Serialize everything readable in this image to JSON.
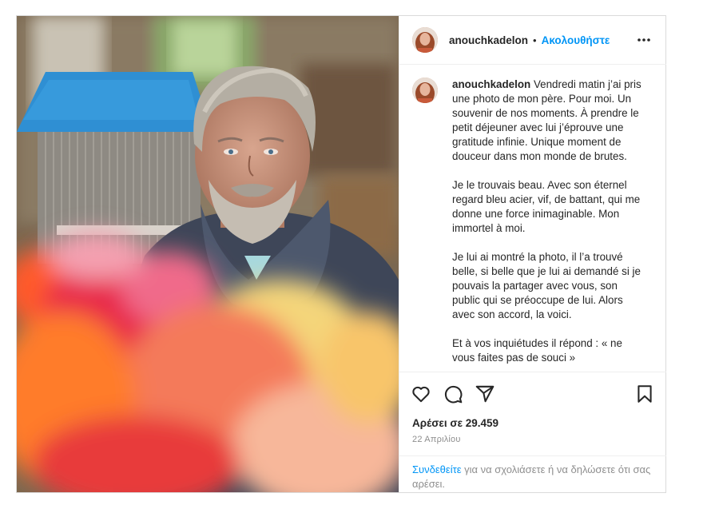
{
  "post": {
    "username": "anouchkadelon",
    "separator": "•",
    "follow_label": "Ακολουθήστε",
    "more_icon": "more-horizontal-icon",
    "caption": {
      "username": "anouchkadelon",
      "paragraphs": [
        "Vendredi matin j’ai pris une photo de mon père. Pour moi. Un souvenir de nos moments. À prendre le petit déjeuner avec lui j’éprouve une gratitude infinie. Unique moment de douceur dans mon monde de brutes.",
        "Je le trouvais beau. Avec son éternel regard bleu acier, vif, de battant, qui me donne une force inimaginable. Mon immortel à moi.",
        "Je lui ai montré la photo, il l’a trouvé belle, si belle que je lui ai demandé si je pouvais la partager avec vous, son public qui se préoccupe de lui. Alors avec son accord, la voici.",
        "Et à vos inquiétudes il répond : « ne vous faites pas de souci »"
      ]
    },
    "actions": {
      "like_icon": "heart-icon",
      "comment_icon": "comment-icon",
      "share_icon": "paper-plane-icon",
      "save_icon": "bookmark-icon"
    },
    "likes": "Αρέσει σε 29.459",
    "date": "22 Απριλίου",
    "login_prompt": {
      "link": "Συνδεθείτε",
      "text": " για να σχολιάσετε ή να δηλώσετε ότι σας αρέσει."
    }
  },
  "colors": {
    "link_blue": "#0095f6",
    "text": "#262626",
    "muted": "#8e8e8e",
    "border": "#dbdbdb"
  }
}
